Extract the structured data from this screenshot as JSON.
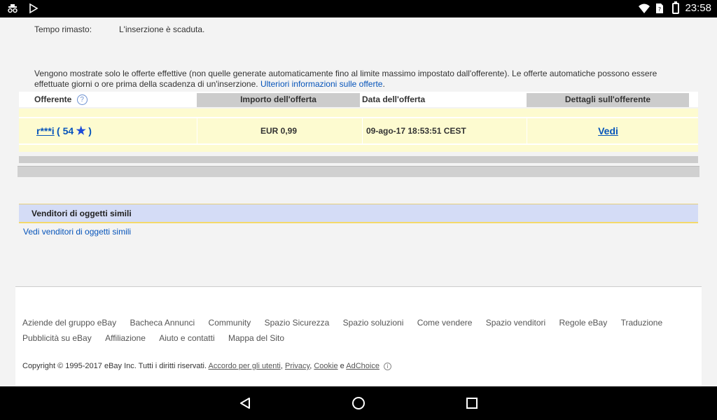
{
  "statusbar": {
    "time": "23:58"
  },
  "auction": {
    "time_left_label": "Tempo rimasto:",
    "time_left_value": "L'inserzione è scaduta."
  },
  "notice": {
    "text": "Vengono mostrate solo le offerte effettive (non quelle generate automaticamente fino al limite massimo impostato dall'offerente). Le offerte automatiche possono essere effettuate giorni o ore prima della scadenza di un'inserzione.",
    "link": "Ulteriori informazioni sulle offerte",
    "trail": "."
  },
  "bids_table": {
    "headers": [
      "Offerente",
      "Importo dell'offerta",
      "Data dell'offerta",
      "Dettagli sull'offerente"
    ],
    "help_glyph": "?",
    "rows": [
      {
        "bidder": "r***i",
        "score_open": "( 54",
        "star": "★",
        "score_close": ")",
        "amount": "EUR 0,99",
        "date": "09-ago-17 18:53:51 CEST",
        "details": "Vedi"
      }
    ]
  },
  "similar": {
    "title": "Venditori di oggetti simili",
    "link": "Vedi venditori di oggetti simili"
  },
  "footer": {
    "links": [
      "Aziende del gruppo eBay",
      "Bacheca Annunci",
      "Community",
      "Spazio Sicurezza",
      "Spazio soluzioni",
      "Come vendere",
      "Spazio venditori",
      "Regole eBay",
      "Traduzione",
      "Pubblicità su eBay",
      "Affiliazione",
      "Aiuto e contatti",
      "Mappa del Sito"
    ],
    "copyright": "Copyright © 1995-2017 eBay Inc. Tutti i diritti riservati.",
    "legal": [
      "Accordo per gli utenti",
      "Privacy",
      "Cookie",
      "AdChoice"
    ],
    "and": "e",
    "comma": ","
  }
}
